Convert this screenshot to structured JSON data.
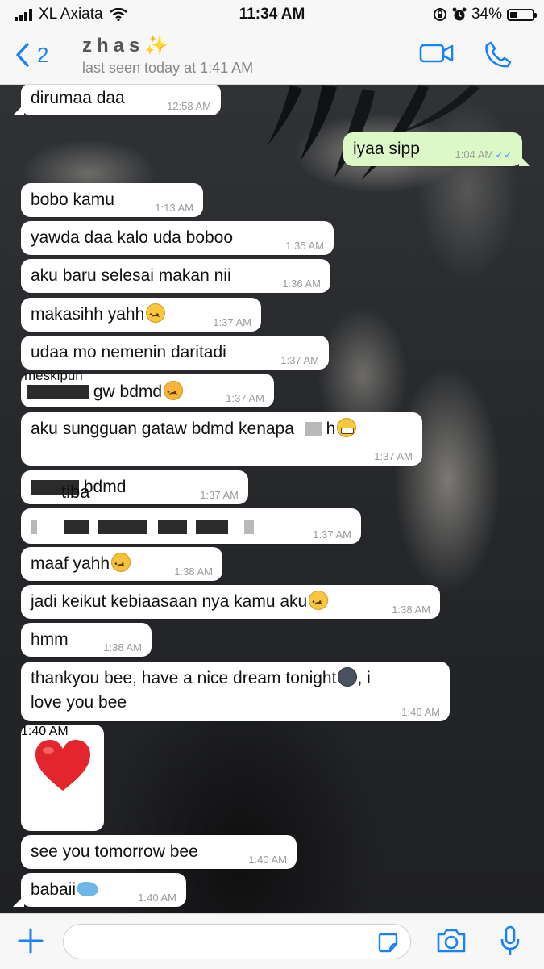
{
  "status_bar": {
    "carrier": "XL Axiata",
    "time": "11:34 AM",
    "battery": "34%",
    "battery_level": 0.34
  },
  "header": {
    "back_count": "2",
    "contact_name": "zhas",
    "contact_sparkle": "✨",
    "last_seen": "last seen today at 1:41 AM"
  },
  "messages": [
    {
      "dir": "in",
      "text": "dirumaa daa",
      "time": "12:58 AM"
    },
    {
      "dir": "out",
      "text": "iyaa sipp",
      "time": "1:04 AM",
      "status": "read"
    },
    {
      "dir": "in",
      "text": "bobo kamu",
      "time": "1:13 AM"
    },
    {
      "dir": "in",
      "text": "yawda daa kalo uda boboo",
      "time": "1:35 AM"
    },
    {
      "dir": "in",
      "text": "aku baru selesai makan nii",
      "time": "1:36 AM"
    },
    {
      "dir": "in",
      "text": "makasihh yahh",
      "emoji": "sad",
      "time": "1:37 AM"
    },
    {
      "dir": "in",
      "text": "udaa mo nemenin daritadi",
      "time": "1:37 AM"
    },
    {
      "dir": "in",
      "overlay": "meskipun",
      "text": "gw bdmd",
      "emoji": "woozy",
      "time": "1:37 AM"
    },
    {
      "dir": "in",
      "text": "aku sungguan gataw bdmd kenapa",
      "suffix": "h",
      "emoji": "grimace",
      "time": "1:37 AM"
    },
    {
      "dir": "in",
      "overlay": "tiba\"",
      "text": "bdmd",
      "time": "1:37 AM"
    },
    {
      "dir": "in",
      "text": "",
      "time": "1:37 AM"
    },
    {
      "dir": "in",
      "text": "maaf yahh",
      "emoji": "pensive",
      "time": "1:38 AM"
    },
    {
      "dir": "in",
      "text": "jadi keikut kebiaasaan nya kamu aku",
      "emoji": "sad",
      "time": "1:38 AM"
    },
    {
      "dir": "in",
      "text": "hmm",
      "time": "1:38 AM"
    },
    {
      "dir": "in",
      "text_line1": "thankyou bee, have a nice dream tonight",
      "emoji": "new-moon-face",
      "text_line1_end": ", i",
      "text_line2": "love you bee",
      "time": "1:40 AM"
    },
    {
      "dir": "in",
      "emoji": "red-heart",
      "time": "1:40 AM"
    },
    {
      "dir": "in",
      "text": "see you tomorrow bee",
      "time": "1:40 AM"
    },
    {
      "dir": "in",
      "text": "babaii",
      "emoji": "whale",
      "time": "1:40 AM"
    }
  ],
  "colors": {
    "incoming_bubble": "#ffffff",
    "outgoing_bubble": "#dcf8c6",
    "accent": "#1a82f7",
    "read_ticks": "#4fa3f7"
  },
  "icons": [
    "signal-bars-icon",
    "wifi-icon",
    "orientation-lock-icon",
    "alarm-icon",
    "battery-icon",
    "back-chevron-icon",
    "video-call-icon",
    "phone-call-icon",
    "plus-icon",
    "sticker-icon",
    "camera-icon",
    "microphone-icon"
  ]
}
